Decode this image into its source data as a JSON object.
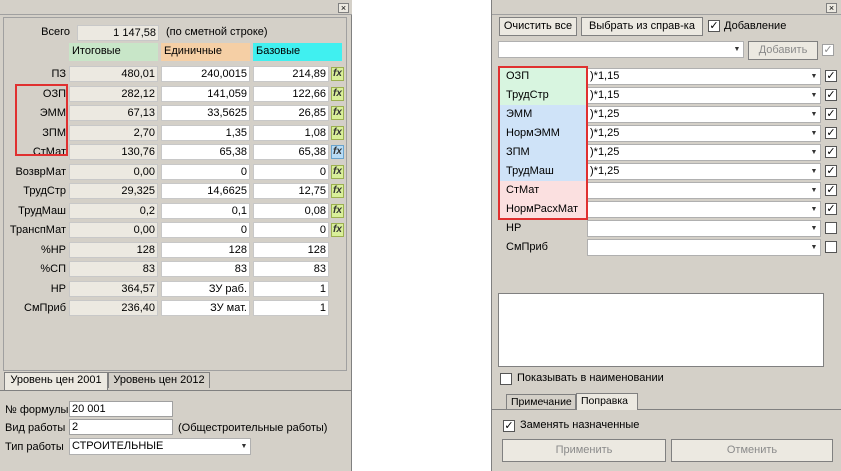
{
  "left": {
    "total_label": "Всего",
    "total_value": "1 147,58",
    "total_note": "(по сметной строке)",
    "headers": {
      "col1": "Итоговые",
      "col2": "Единичные",
      "col3": "Базовые"
    },
    "header_colors": {
      "col1": "#c8e6c8",
      "col2": "#f5cfa5",
      "col3": "#40f0f0"
    },
    "rows": [
      {
        "label": "ПЗ",
        "v1": "480,01",
        "v2": "240,0015",
        "v3": "214,89",
        "fx": "green"
      },
      {
        "label": "ОЗП",
        "v1": "282,12",
        "v2": "141,059",
        "v3": "122,66",
        "fx": "green"
      },
      {
        "label": "ЭММ",
        "v1": "67,13",
        "v2": "33,5625",
        "v3": "26,85",
        "fx": "green"
      },
      {
        "label": "ЗПМ",
        "v1": "2,70",
        "v2": "1,35",
        "v3": "1,08",
        "fx": "green"
      },
      {
        "label": "СтМат",
        "v1": "130,76",
        "v2": "65,38",
        "v3": "65,38",
        "fx": "blue"
      },
      {
        "label": "ВозврМат",
        "v1": "0,00",
        "v2": "0",
        "v3": "0",
        "fx": "green"
      },
      {
        "label": "ТрудСтр",
        "v1": "29,325",
        "v2": "14,6625",
        "v3": "12,75",
        "fx": "green"
      },
      {
        "label": "ТрудМаш",
        "v1": "0,2",
        "v2": "0,1",
        "v3": "0,08",
        "fx": "green"
      },
      {
        "label": "ТранспМат",
        "v1": "0,00",
        "v2": "0",
        "v3": "0",
        "fx": "green"
      },
      {
        "label": "%НР",
        "v1": "128",
        "v2": "128",
        "v3": "128",
        "fx": "none"
      },
      {
        "label": "%СП",
        "v1": "83",
        "v2": "83",
        "v3": "83",
        "fx": "none"
      },
      {
        "label": "НР",
        "v1": "364,57",
        "v2": "ЗУ раб.",
        "v3": "1",
        "fx": "none"
      },
      {
        "label": "СмПриб",
        "v1": "236,40",
        "v2": "ЗУ мат.",
        "v3": "1",
        "fx": "none"
      }
    ],
    "tabs": [
      "Уровень цен 2001",
      "Уровень цен 2012"
    ],
    "formula_label": "№ формулы",
    "formula_value": "20 001",
    "worktype_label": "Вид работы",
    "worktype_value": "2",
    "worktype_note": "(Общестроительные работы)",
    "workkind_label": "Тип работы",
    "workkind_value": "СТРОИТЕЛЬНЫЕ",
    "close_glyph": "×",
    "fx_glyph": "fx"
  },
  "right": {
    "clear_button": "Очистить все",
    "pick_button": "Выбрать из справ-ка",
    "add_check_label": "Добавление",
    "add_button": "Добавить",
    "rows": [
      {
        "name": "ОЗП",
        "value": ")*1,15",
        "checked": true,
        "bg": "#d8f5e0"
      },
      {
        "name": "ТрудСтр",
        "value": ")*1,15",
        "checked": true,
        "bg": "#d8f5e0"
      },
      {
        "name": "ЭММ",
        "value": ")*1,25",
        "checked": true,
        "bg": "#cfe3f8"
      },
      {
        "name": "НормЭММ",
        "value": ")*1,25",
        "checked": true,
        "bg": "#cfe3f8"
      },
      {
        "name": "ЗПМ",
        "value": ")*1,25",
        "checked": true,
        "bg": "#cfe3f8"
      },
      {
        "name": "ТрудМаш",
        "value": ")*1,25",
        "checked": true,
        "bg": "#cfe3f8"
      },
      {
        "name": "СтМат",
        "value": "",
        "checked": true,
        "bg": "#fbe0e0"
      },
      {
        "name": "НормРасхМат",
        "value": "",
        "checked": true,
        "bg": "#fbe0e0"
      },
      {
        "name": "НР",
        "value": "",
        "checked": false,
        "bg": "#d4d0c8"
      },
      {
        "name": "СмПриб",
        "value": "",
        "checked": false,
        "bg": "#d4d0c8"
      }
    ],
    "show_in_name_label": "Показывать в наименовании",
    "tabs": [
      "Примечание",
      "Поправка"
    ],
    "replace_label": "Заменять назначенные",
    "apply_button": "Применить",
    "cancel_button": "Отменить",
    "close_glyph": "×",
    "check_glyph": "✓",
    "arrow_glyph": "▼"
  }
}
